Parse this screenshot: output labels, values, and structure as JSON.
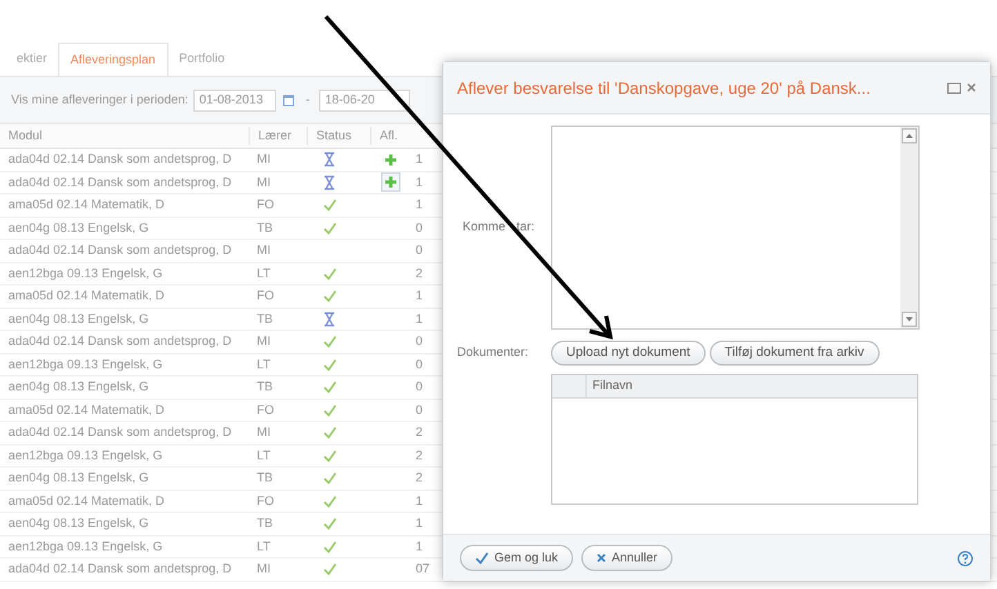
{
  "tabs": [
    {
      "label": "ektier",
      "selected": false
    },
    {
      "label": "Afleveringsplan",
      "selected": true
    },
    {
      "label": "Portfolio",
      "selected": false
    }
  ],
  "filter": {
    "label": "Vis mine afleveringer i perioden:",
    "from": "01-08-2013",
    "separator": "-",
    "to": "18-06-20"
  },
  "table": {
    "columns": [
      "Modul",
      "Lærer",
      "Status",
      "Afl."
    ],
    "rows": [
      {
        "modul": "ada04d 02.14 Dansk som andetsprog, D",
        "laerer": "MI",
        "kind": "pending",
        "submit": true,
        "submit_selected": false,
        "column_5": "1"
      },
      {
        "modul": "ada04d 02.14 Dansk som andetsprog, D",
        "laerer": "MI",
        "kind": "pending",
        "submit": true,
        "submit_selected": true,
        "column_5": "1"
      },
      {
        "modul": "ama05d 02.14 Matematik, D",
        "laerer": "FO",
        "kind": "done",
        "submit": false,
        "column_5": "1"
      },
      {
        "modul": "aen04g 08.13 Engelsk, G",
        "laerer": "TB",
        "kind": "done",
        "submit": false,
        "column_5": "0"
      },
      {
        "modul": "ada04d 02.14 Dansk som andetsprog, D",
        "laerer": "MI",
        "kind": "none",
        "submit": false,
        "column_5": "0"
      },
      {
        "modul": "aen12bga 09.13 Engelsk, G",
        "laerer": "LT",
        "kind": "done",
        "submit": false,
        "column_5": "2"
      },
      {
        "modul": "ama05d 02.14 Matematik, D",
        "laerer": "FO",
        "kind": "done",
        "submit": false,
        "column_5": "1"
      },
      {
        "modul": "aen04g 08.13 Engelsk, G",
        "laerer": "TB",
        "kind": "pending",
        "submit": false,
        "column_5": "1"
      },
      {
        "modul": "ada04d 02.14 Dansk som andetsprog, D",
        "laerer": "MI",
        "kind": "done",
        "submit": false,
        "column_5": "0"
      },
      {
        "modul": "aen12bga 09.13 Engelsk, G",
        "laerer": "LT",
        "kind": "done",
        "submit": false,
        "column_5": "0"
      },
      {
        "modul": "aen04g 08.13 Engelsk, G",
        "laerer": "TB",
        "kind": "done",
        "submit": false,
        "column_5": "0"
      },
      {
        "modul": "ama05d 02.14 Matematik, D",
        "laerer": "FO",
        "kind": "done",
        "submit": false,
        "column_5": "0"
      },
      {
        "modul": "ada04d 02.14 Dansk som andetsprog, D",
        "laerer": "MI",
        "kind": "done",
        "submit": false,
        "column_5": "2"
      },
      {
        "modul": "aen12bga 09.13 Engelsk, G",
        "laerer": "LT",
        "kind": "done",
        "submit": false,
        "column_5": "2"
      },
      {
        "modul": "aen04g 08.13 Engelsk, G",
        "laerer": "TB",
        "kind": "done",
        "submit": false,
        "column_5": "2"
      },
      {
        "modul": "ama05d 02.14 Matematik, D",
        "laerer": "FO",
        "kind": "done",
        "submit": false,
        "column_5": "1"
      },
      {
        "modul": "aen04g 08.13 Engelsk, G",
        "laerer": "TB",
        "kind": "done",
        "submit": false,
        "column_5": "1"
      },
      {
        "modul": "aen12bga 09.13 Engelsk, G",
        "laerer": "LT",
        "kind": "done",
        "submit": false,
        "column_5": "1"
      },
      {
        "modul": "ada04d 02.14 Dansk som andetsprog, D",
        "laerer": "MI",
        "kind": "done",
        "submit": false,
        "column_5": "07"
      }
    ]
  },
  "dialog": {
    "title": "Aflever besvarelse til 'Danskopgave, uge 20' på Dansk...",
    "comment_label_parts": [
      "Komme",
      "tar:"
    ],
    "documents_label": "Dokumenter:",
    "document_buttons": [
      "Upload nyt dokument",
      "Tilføj dokument fra arkiv"
    ],
    "file_table": {
      "columns": [
        "Filnavn"
      ]
    },
    "footer_buttons": [
      {
        "label": "Gem og luk",
        "kind": "save"
      },
      {
        "label": "Annuller",
        "kind": "cancel"
      }
    ]
  }
}
